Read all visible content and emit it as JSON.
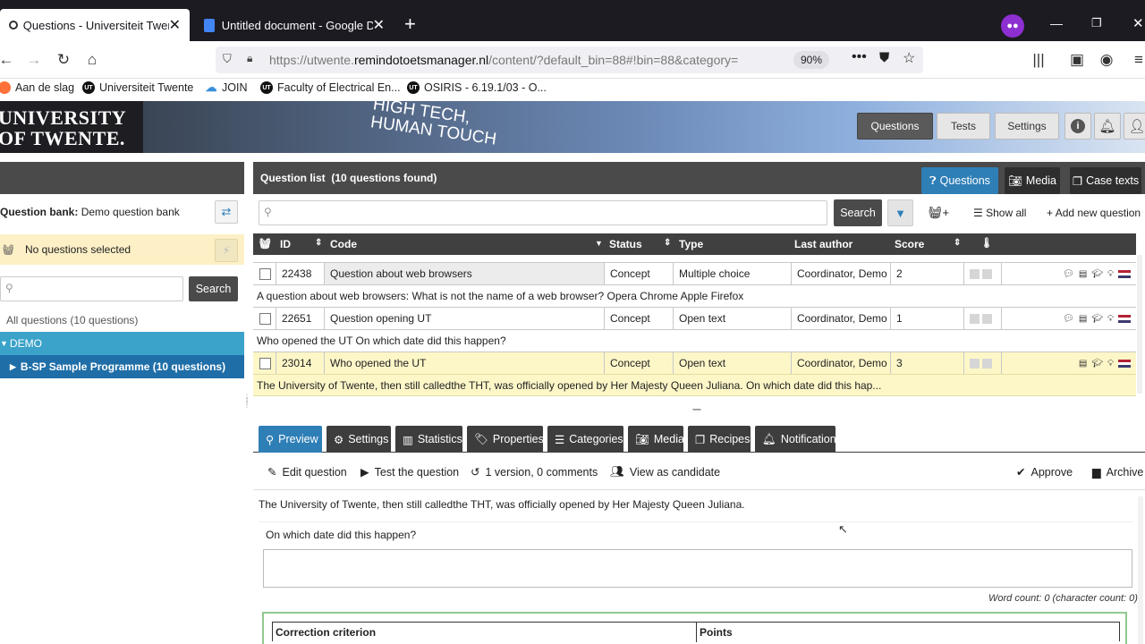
{
  "browser": {
    "tabs": [
      {
        "title": "Questions - Universiteit Twente",
        "active": true
      },
      {
        "title": "Untitled document - Google Docs",
        "active": false
      }
    ],
    "new_tab": "+",
    "url_prefix": "https://utwente.",
    "url_domain": "remindotoetsmanager.nl",
    "url_path": "/content/?default_bin=88#!bin=88&category=",
    "zoom": "90%",
    "bookmarks": [
      {
        "label": "Aan de slag",
        "icon": "firefox-icon"
      },
      {
        "label": "Universiteit Twente",
        "icon": "ut-icon"
      },
      {
        "label": "JOIN",
        "icon": "cloud-icon"
      },
      {
        "label": "Faculty of Electrical En...",
        "icon": "ut-icon"
      },
      {
        "label": "OSIRIS - 6.19.1/03 - O...",
        "icon": "ut-icon"
      }
    ]
  },
  "header": {
    "logo_line1": "UNIVERSITY",
    "logo_line2": "OF TWENTE.",
    "banner_line1": "HIGH TECH,",
    "banner_line2": "HUMAN TOUCH",
    "nav": [
      "Questions",
      "Tests",
      "Settings"
    ]
  },
  "sidebar": {
    "bank_label": "Question bank:",
    "bank_name": "Demo question bank",
    "no_selection": "No questions selected",
    "search_placeholder": "",
    "search_button": "Search",
    "all_questions": "All questions (10 questions)",
    "tree": [
      {
        "label": "DEMO",
        "level": 0
      },
      {
        "label": "B-SP Sample Programme (10 questions)",
        "level": 1
      }
    ]
  },
  "list": {
    "title": "Question list",
    "count": "(10 questions found)",
    "tabs": [
      "Questions",
      "Media",
      "Case texts"
    ],
    "search_button": "Search",
    "show_all": "Show all",
    "add_new": "Add new question",
    "columns": [
      "ID",
      "Code",
      "Status",
      "Type",
      "Last author",
      "Score"
    ],
    "rows": [
      {
        "id": "22438",
        "code": "Question about web browsers",
        "status": "Concept",
        "type": "Multiple choice",
        "author": "Coordinator, Demo",
        "score": "2",
        "summary": "A question about web browsers: What is not the name of a web browser? Opera Chrome Apple Firefox",
        "selected": false
      },
      {
        "id": "22651",
        "code": "Question opening UT",
        "status": "Concept",
        "type": "Open text",
        "author": "Coordinator, Demo",
        "score": "1",
        "summary": "Who opened the UT On which date did this happen?",
        "selected": false
      },
      {
        "id": "23014",
        "code": "Who opened the UT",
        "status": "Concept",
        "type": "Open text",
        "author": "Coordinator, Demo",
        "score": "3",
        "summary": "The University of Twente, then still calledthe THT, was officially opened by Her Majesty Queen Juliana. On which date did this hap...",
        "selected": true
      }
    ]
  },
  "preview": {
    "tabs": [
      "Preview",
      "Settings",
      "Statistics",
      "Properties",
      "Categories",
      "Media",
      "Recipes",
      "Notifications"
    ],
    "actions": {
      "edit": "Edit question",
      "test": "Test the question",
      "versions": "1 version, 0 comments",
      "candidate": "View as candidate",
      "approve": "Approve",
      "archive": "Archive"
    },
    "intro": "The University of Twente, then still calledthe THT, was officially opened by Her Majesty Queen Juliana.",
    "question": "On which date did this happen?",
    "word_count": "Word count: 0 (character count: 0)",
    "criteria_header": "Correction criterion",
    "points_header": "Points"
  },
  "colors": {
    "accent": "#2f7fb7",
    "tree_level0": "#3ba3c9",
    "tree_level1": "#1f6ea8",
    "selected_row": "#fdf7c8",
    "warning_bg": "#fdf0c6"
  }
}
